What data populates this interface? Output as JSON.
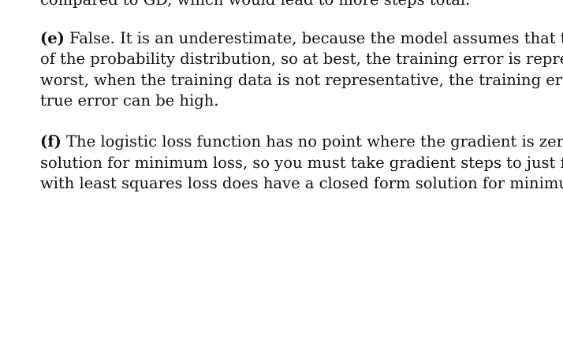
{
  "document": {
    "top_fragment": "compared to GD, which would lead to more steps total.",
    "para_e": {
      "label": "(e)",
      "lines": [
        " False. It is an underestimate, because the model assumes that the tr",
        "of the probability distribution, so at best, the training error is represe",
        "worst, when the training data is not representative, the training erro",
        "true error can be high."
      ]
    },
    "para_f": {
      "label": "(f)",
      "lines": [
        " The logistic loss function has no point where the gradient is zero",
        "solution for minimum loss, so you must take gradient steps to just find",
        "with least squares loss does have a closed form solution for minimum l"
      ]
    }
  }
}
